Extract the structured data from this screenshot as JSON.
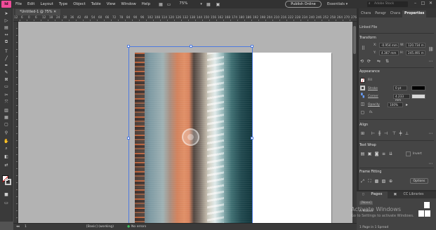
{
  "menubar": {
    "app_logo": "Id",
    "menus": [
      "File",
      "Edit",
      "Layout",
      "Type",
      "Object",
      "Table",
      "View",
      "Window",
      "Help"
    ],
    "zoom": "75%",
    "publish_label": "Publish Online",
    "workspace": "Essentials",
    "search_placeholder": "Adobe Stock"
  },
  "document": {
    "tab_title": "*Untitled-1 @ 75%"
  },
  "ruler": {
    "top_labels": [
      "12",
      "6",
      "0",
      "6",
      "12",
      "18",
      "24",
      "30",
      "36",
      "42",
      "48",
      "54",
      "60",
      "66",
      "72",
      "78",
      "84",
      "90",
      "96",
      "102",
      "108",
      "114",
      "120",
      "126",
      "132",
      "138",
      "144",
      "150",
      "156",
      "162",
      "168",
      "174",
      "180",
      "186",
      "192",
      "198",
      "204",
      "210",
      "216",
      "222",
      "228",
      "234",
      "240",
      "246",
      "252",
      "258",
      "264",
      "270",
      "276"
    ]
  },
  "panel": {
    "tabs": [
      "Chara",
      "Paragr",
      "Chara",
      "Properties"
    ],
    "object_kind": "Linked File",
    "transform": {
      "title": "Transform",
      "x_label": "X:",
      "x_value": "-0.954 mm",
      "y_label": "Y:",
      "y_value": "4.367 mm",
      "w_label": "W:",
      "w_value": "120.734 m",
      "h_label": "H:",
      "h_value": "245.491 m"
    },
    "appearance": {
      "title": "Appearance",
      "fill_label": "Fill",
      "stroke_label": "Stroke",
      "stroke_weight": "0 pt",
      "corner_label": "Corner",
      "corner_value": "4.233 mm",
      "opacity_label": "Opacity",
      "opacity_value": "100%",
      "fx_label": "fx."
    },
    "align": {
      "title": "Align"
    },
    "text_wrap": {
      "title": "Text Wrap",
      "invert_label": "Invert"
    },
    "frame_fitting": {
      "title": "Frame Fitting",
      "options_label": "Options"
    }
  },
  "pages_panel": {
    "tabs": [
      "Pages",
      "CC Libraries"
    ],
    "none_label": "[None]",
    "master_label": "A-Master",
    "footer": "1 Page in 1 Spread"
  },
  "statusbar": {
    "page": "1",
    "master": "[Basic] (working)",
    "errors": "No errors"
  },
  "watermark": {
    "line1": "Activate Windows",
    "line2": "Go to Settings to activate Windows."
  },
  "colors": {
    "accent_selection": "#4e7be0",
    "indesign_brand": "#f04c9a"
  }
}
